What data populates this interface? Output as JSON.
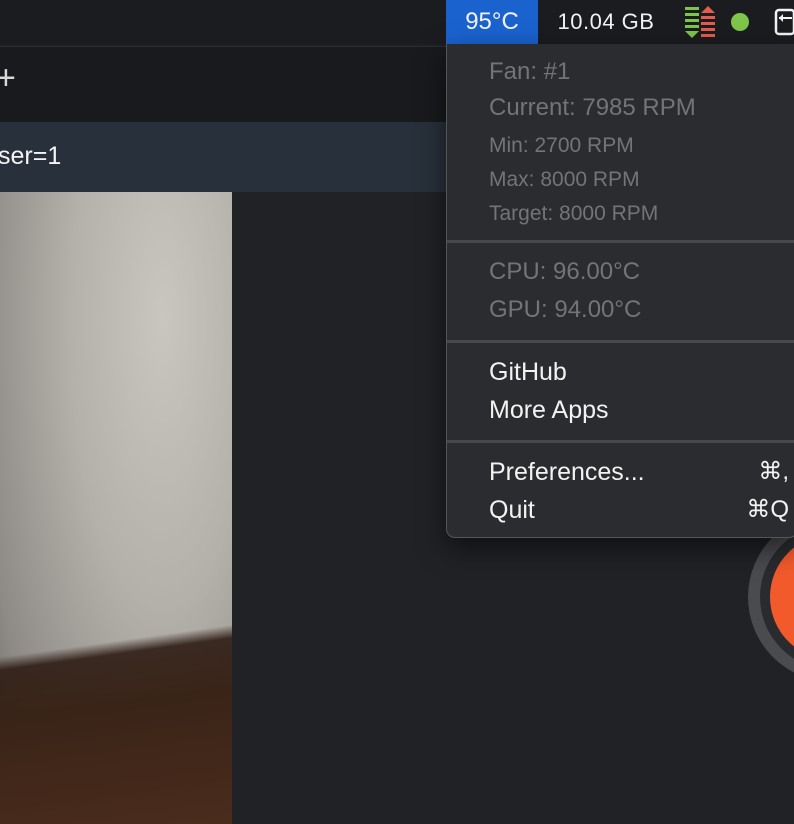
{
  "menubar": {
    "temperature": "95°C",
    "memory": "10.04 GB",
    "icons": [
      "network-updown-icon",
      "status-dot-icon",
      "app-window-icon"
    ],
    "colors": {
      "temp_highlight": "#1a63cf",
      "status_dot": "#7ec54a",
      "net_up": "#e65a4f",
      "net_down": "#7ec54a"
    }
  },
  "window": {
    "toolbar_glyph": "+",
    "url_text": "ser=1"
  },
  "dropdown": {
    "fan": {
      "title": "Fan: #1",
      "current": "Current: 7985 RPM",
      "min": "Min: 2700 RPM",
      "max": "Max: 8000 RPM",
      "target": "Target: 8000 RPM"
    },
    "sensors": {
      "cpu": "CPU: 96.00°C",
      "gpu": "GPU: 94.00°C"
    },
    "links": {
      "github": "GitHub",
      "more_apps": "More Apps"
    },
    "actions": {
      "preferences": "Preferences...",
      "preferences_shortcut": "⌘,",
      "quit": "Quit",
      "quit_shortcut": "⌘Q"
    }
  },
  "record_button": {
    "color": "#f25a2c"
  }
}
